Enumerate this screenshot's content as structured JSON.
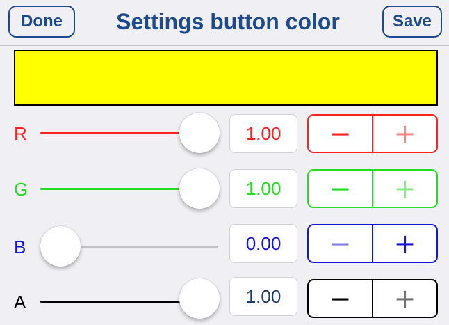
{
  "header": {
    "done_label": "Done",
    "title": "Settings button color",
    "save_label": "Save"
  },
  "preview": {
    "color": "#ffff00"
  },
  "channels": [
    {
      "label": "R",
      "value": 1.0,
      "value_text": "1.00",
      "color": "#ff2020",
      "minus": "−",
      "plus": "+",
      "minus_enabled": true,
      "plus_enabled": false
    },
    {
      "label": "G",
      "value": 1.0,
      "value_text": "1.00",
      "color": "#22dd22",
      "minus": "−",
      "plus": "+",
      "minus_enabled": true,
      "plus_enabled": false
    },
    {
      "label": "B",
      "value": 0.0,
      "value_text": "0.00",
      "color": "#1414d8",
      "minus": "−",
      "plus": "+",
      "minus_enabled": false,
      "plus_enabled": true
    },
    {
      "label": "A",
      "value": 1.0,
      "value_text": "1.00",
      "color": "#000000",
      "minus": "−",
      "plus": "+",
      "minus_enabled": true,
      "plus_enabled": false
    }
  ],
  "value_text_colors": [
    "#ff2020",
    "#22dd22",
    "#1414d8",
    "#1c3c6a"
  ],
  "unfilled_track_color": "#c2c2c6"
}
